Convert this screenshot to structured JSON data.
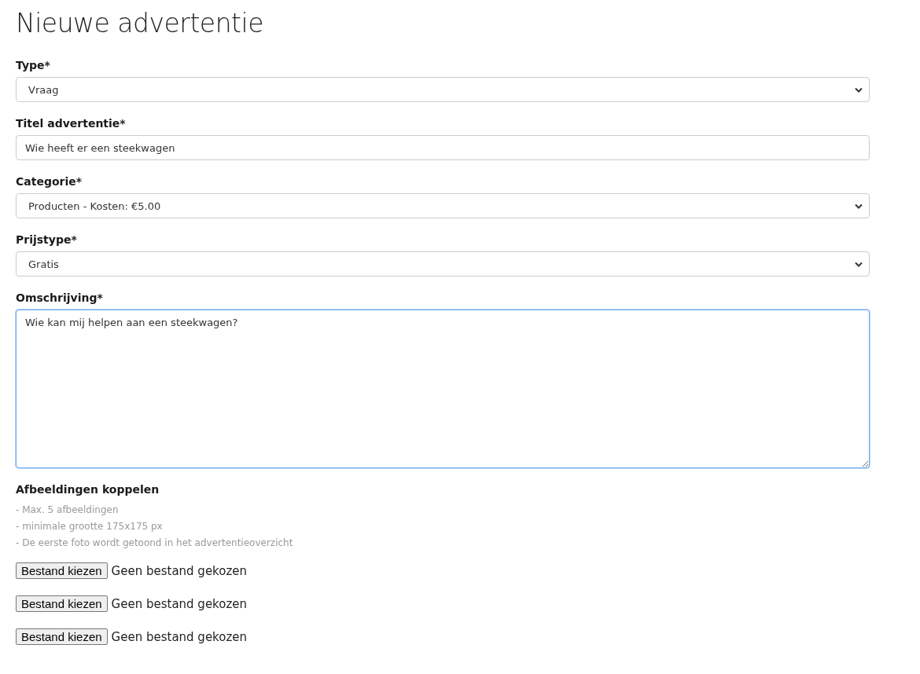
{
  "title": "Nieuwe advertentie",
  "fields": [
    {
      "label": "Type*",
      "kind": "select",
      "value": "Vraag",
      "focused": false
    },
    {
      "label": "Titel advertentie*",
      "kind": "text",
      "value": "Wie heeft er een steekwagen",
      "focused": false
    },
    {
      "label": "Categorie*",
      "kind": "select",
      "value": "Producten - Kosten: €5.00",
      "focused": false
    },
    {
      "label": "Prijstype*",
      "kind": "select",
      "value": "Gratis",
      "focused": false
    },
    {
      "label": "Omschrijving*",
      "kind": "textarea",
      "value": "Wie kan mij helpen aan een steekwagen?",
      "focused": true
    }
  ],
  "images": {
    "label": "Afbeeldingen koppelen",
    "notes": [
      "- Max. 5 afbeeldingen",
      "- minimale grootte 175x175 px",
      "- De eerste foto wordt getoond in het advertentieoverzicht"
    ],
    "uploads": [
      {
        "button": "Bestand kiezen",
        "status": "Geen bestand gekozen"
      },
      {
        "button": "Bestand kiezen",
        "status": "Geen bestand gekozen"
      },
      {
        "button": "Bestand kiezen",
        "status": "Geen bestand gekozen"
      }
    ]
  }
}
